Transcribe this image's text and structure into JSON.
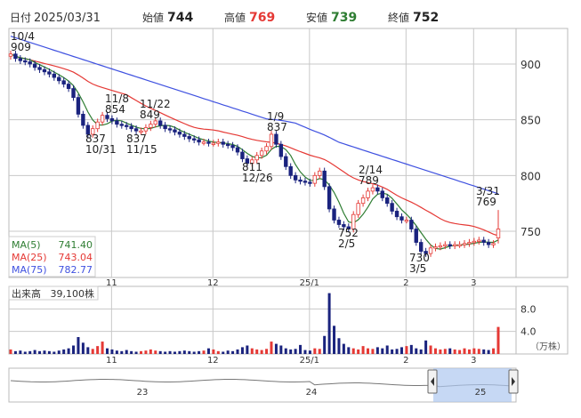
{
  "header": {
    "date_label": "日付",
    "date": "2025/03/31",
    "open_label": "始値",
    "open": "744",
    "high_label": "高値",
    "high": "769",
    "low_label": "安値",
    "low": "739",
    "close_label": "終値",
    "close": "752"
  },
  "legend": {
    "ma5": "MA(5)",
    "ma5_value": "741.40",
    "ma25": "MA(25)",
    "ma25_value": "743.04",
    "ma75": "MA(75)",
    "ma75_value": "782.77"
  },
  "volume_panel": {
    "title": "出来高",
    "value": "39,100株",
    "unit": "（万株）"
  },
  "colors": {
    "ma5": "#2e7d32",
    "ma25": "#e53935",
    "ma75": "#3f51e0",
    "candle_up": "#e53935",
    "candle_down": "#1a237e",
    "volume_down": "#1a237e",
    "volume_up": "#e53935",
    "grid": "#c8c8c8",
    "nav_range": "#aec8ef"
  },
  "navigator": {
    "labels": [
      "23",
      "24",
      "25"
    ]
  },
  "chart_data": [
    {
      "type": "candlestick",
      "title": "",
      "ylim": [
        710,
        930
      ],
      "y_ticks": [
        "900",
        "850",
        "800",
        "750"
      ],
      "x_tick_labels": [
        "11",
        "12",
        "25/1",
        "2",
        "3"
      ],
      "close": [
        909,
        905,
        903,
        902,
        900,
        897,
        895,
        893,
        891,
        888,
        885,
        882,
        878,
        870,
        855,
        845,
        837,
        842,
        848,
        854,
        851,
        849,
        846,
        845,
        844,
        842,
        840,
        840,
        843,
        846,
        849,
        845,
        842,
        841,
        839,
        837,
        835,
        833,
        832,
        830,
        830,
        829,
        829,
        830,
        828,
        827,
        825,
        821,
        815,
        811,
        814,
        818,
        822,
        826,
        837,
        828,
        817,
        808,
        800,
        796,
        795,
        794,
        793,
        800,
        804,
        790,
        770,
        760,
        756,
        754,
        752,
        765,
        775,
        780,
        786,
        789,
        786,
        780,
        775,
        768,
        763,
        760,
        760,
        752,
        740,
        732,
        730,
        735,
        736,
        737,
        738,
        737,
        738,
        738,
        739,
        740,
        741,
        742,
        740,
        738,
        739,
        752
      ],
      "annotations": [
        {
          "label": "10/4",
          "value": "909"
        },
        {
          "label": "11/8",
          "value": "854"
        },
        {
          "label": "11/22",
          "value": "849"
        },
        {
          "label": "837",
          "date": "10/31"
        },
        {
          "label": "837",
          "date": "11/15"
        },
        {
          "label": "1/9",
          "value": "837"
        },
        {
          "label": "811",
          "date": "12/26"
        },
        {
          "label": "2/14",
          "value": "789"
        },
        {
          "label": "752",
          "date": "2/5"
        },
        {
          "label": "730",
          "date": "3/5"
        },
        {
          "label": "3/31",
          "value": "769"
        }
      ],
      "series": [
        {
          "name": "MA(5)",
          "last": 741.4
        },
        {
          "name": "MA(25)",
          "last": 743.04
        },
        {
          "name": "MA(75)",
          "last": 782.77
        }
      ]
    },
    {
      "type": "bar",
      "title": "出来高",
      "ylabel": "（万株）",
      "ylim": [
        0,
        12
      ],
      "y_ticks": [
        "8.0",
        "4.0"
      ],
      "x_tick_labels": [
        "11",
        "12",
        "25/1",
        "2",
        "3"
      ],
      "values": [
        0.8,
        0.5,
        0.6,
        0.4,
        0.5,
        0.7,
        0.5,
        0.6,
        0.5,
        0.4,
        0.6,
        0.8,
        1.0,
        1.5,
        3.0,
        2.0,
        1.2,
        0.9,
        1.4,
        2.2,
        1.0,
        0.8,
        0.6,
        0.5,
        0.7,
        0.5,
        0.4,
        0.5,
        0.6,
        0.8,
        0.6,
        0.5,
        0.4,
        0.5,
        0.4,
        0.5,
        0.6,
        0.5,
        0.4,
        0.5,
        0.6,
        1.0,
        0.8,
        0.5,
        0.4,
        0.6,
        0.5,
        0.8,
        1.2,
        1.5,
        1.0,
        0.8,
        0.7,
        0.9,
        2.2,
        1.8,
        1.5,
        1.0,
        0.8,
        0.9,
        1.6,
        0.7,
        0.6,
        1.0,
        0.9,
        3.2,
        10.8,
        5.0,
        2.8,
        1.8,
        1.2,
        1.0,
        0.8,
        1.4,
        1.0,
        0.9,
        1.2,
        1.0,
        1.5,
        0.8,
        0.9,
        1.2,
        1.4,
        1.6,
        1.0,
        0.8,
        2.4,
        1.5,
        1.0,
        0.8,
        0.9,
        1.0,
        0.8,
        0.7,
        1.0,
        0.8,
        1.0,
        0.9,
        0.8,
        0.7,
        1.0,
        4.8
      ]
    }
  ]
}
